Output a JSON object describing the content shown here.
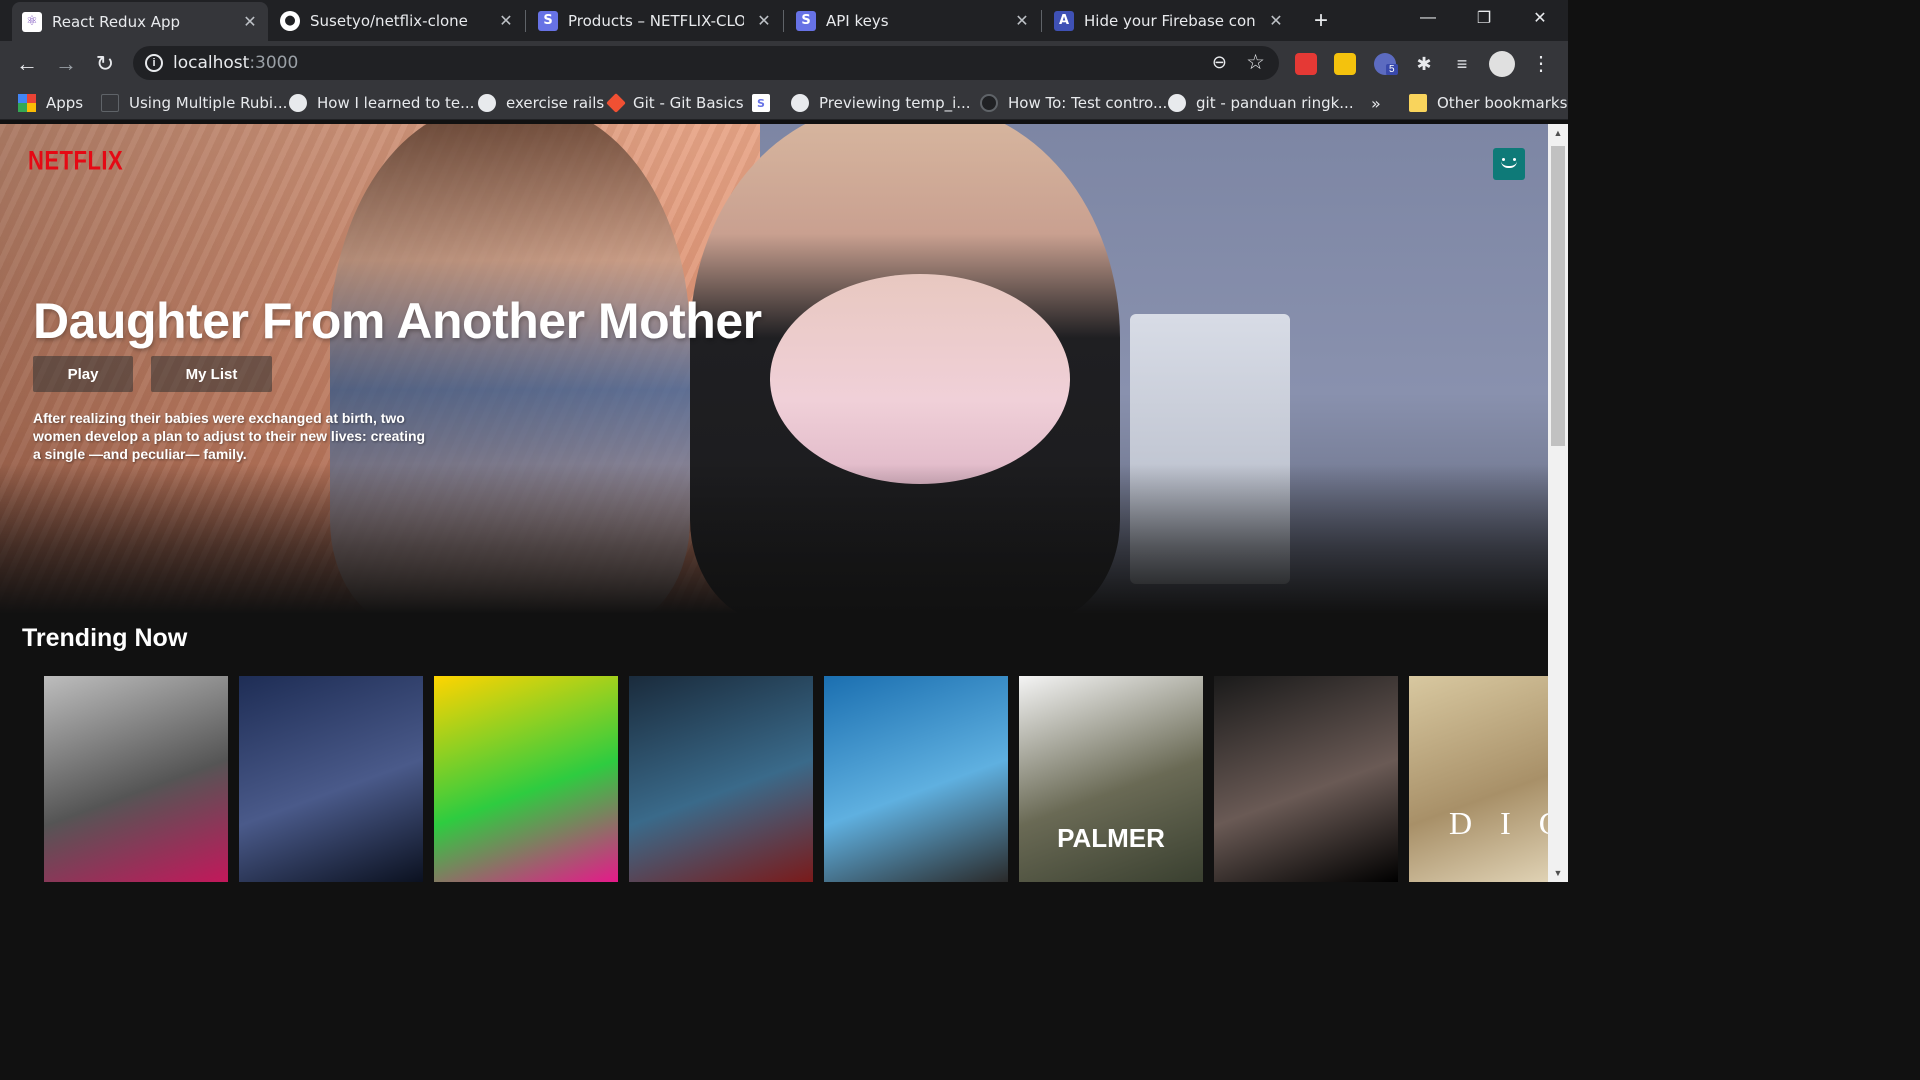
{
  "browser": {
    "tabs": [
      {
        "title": "React Redux App",
        "active": true
      },
      {
        "title": "Susetyo/netflix-clone",
        "active": false
      },
      {
        "title": "Products – NETFLIX-CLONE",
        "active": false
      },
      {
        "title": "API keys",
        "active": false
      },
      {
        "title": "Hide your Firebase config w",
        "active": false
      }
    ],
    "url_host": "localhost",
    "url_port": ":3000",
    "extension_badge": "5",
    "bookmarks": [
      "Apps",
      "Using Multiple Rubi...",
      "How I learned to te...",
      "exercise rails",
      "Git - Git Basics",
      "Previewing temp_i...",
      "How To: Test contro...",
      "git - panduan ringk..."
    ],
    "overflow_label": "»",
    "other_bookmarks": "Other bookmarks"
  },
  "page": {
    "logo": "NETFLIX",
    "banner": {
      "title": "Daughter From Another Mother",
      "play_label": "Play",
      "mylist_label": "My List",
      "description": "After realizing their babies were exchanged at birth, two women develop a plan to adjust to their new lives: creating a single —and peculiar— family."
    },
    "row": {
      "title": "Trending Now",
      "posters": [
        {
          "label": "",
          "colors": [
            "#bdbdbd",
            "#555",
            "#c2185b"
          ]
        },
        {
          "label": "",
          "colors": [
            "#1e2d55",
            "#4a5a8a",
            "#0b1120"
          ]
        },
        {
          "label": "",
          "colors": [
            "#ffd400",
            "#2ecc40",
            "#e6198a"
          ]
        },
        {
          "label": "",
          "colors": [
            "#1a2b3c",
            "#3a6a8a",
            "#7a1a1a"
          ]
        },
        {
          "label": "",
          "colors": [
            "#1b6fb0",
            "#5fb0e0",
            "#2a2a2a"
          ]
        },
        {
          "label": "PALMER",
          "colors": [
            "#f4f4f4",
            "#6a6a55",
            "#3a4030"
          ]
        },
        {
          "label": "",
          "colors": [
            "#1a1a1a",
            "#6a5a55",
            "#000000"
          ]
        },
        {
          "label": "D I G",
          "colors": [
            "#d8c8a0",
            "#a89068",
            "#e8dcc0"
          ]
        }
      ]
    }
  }
}
